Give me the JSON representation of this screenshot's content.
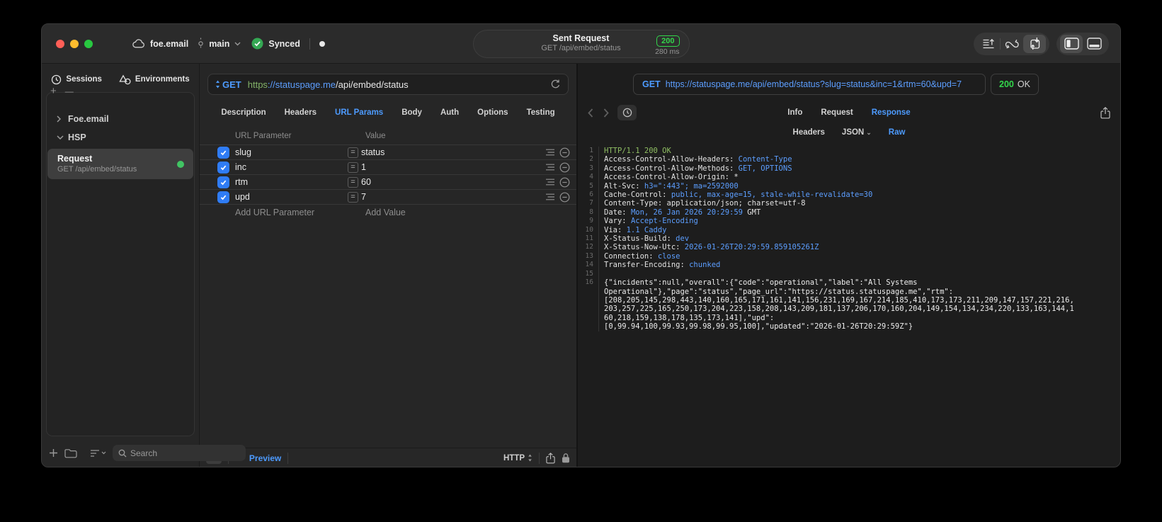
{
  "colors": {
    "accent_blue": "#4D9BFF",
    "status_green": "#32D74B",
    "scheme_green": "#83B268",
    "code_value_blue": "#5C9EFF",
    "code_status_green": "#8FBE63",
    "checkbox_blue": "#2F7CF6",
    "synced_dot_green": "#41C463"
  },
  "titlebar": {
    "project": "foe.email",
    "branch": "main",
    "sync_label": "Synced",
    "request_title": "Sent Request",
    "request_subtitle": "GET /api/embed/status",
    "status_code": "200",
    "duration": "280 ms"
  },
  "sidebar": {
    "tabs": {
      "sessions": "Sessions",
      "environments": "Environments"
    },
    "add_label": "+",
    "remove_label": "—",
    "tree": {
      "group1": "Foe.email",
      "group2": "HSP"
    },
    "request_item": {
      "title": "Request",
      "subtitle": "GET /api/embed/status"
    },
    "search_placeholder": "Search"
  },
  "request_pane": {
    "method": "GET",
    "url": {
      "scheme": "https",
      "host": "://statuspage.me",
      "path": "/api/embed/status"
    },
    "tabs": [
      "Description",
      "Headers",
      "URL Params",
      "Body",
      "Auth",
      "Options",
      "Testing"
    ],
    "active_tab": "URL Params",
    "table": {
      "col_param": "URL Parameter",
      "col_value": "Value",
      "eq": "=",
      "rows": [
        {
          "name": "slug",
          "value": "status",
          "checked": true
        },
        {
          "name": "inc",
          "value": "1",
          "checked": true
        },
        {
          "name": "rtm",
          "value": "60",
          "checked": true
        },
        {
          "name": "upd",
          "value": "7",
          "checked": true
        }
      ],
      "add_param_label": "Add URL Parameter",
      "add_value_label": "Add Value"
    },
    "footer": {
      "code_glyph": "</>",
      "preview_label": "Preview",
      "protocol": "HTTP"
    }
  },
  "response_pane": {
    "method": "GET",
    "url": "https://statuspage.me/api/embed/status?slug=status&inc=1&rtm=60&upd=7",
    "status_code": "200",
    "status_text": "OK",
    "tabs": [
      "Info",
      "Request",
      "Response"
    ],
    "active_tab": "Response",
    "subtabs": [
      "Headers",
      "JSON",
      "Raw"
    ],
    "active_subtab": "Raw",
    "code": {
      "status_line": "HTTP/1.1 200 OK",
      "headers": [
        {
          "name": "Access-Control-Allow-Headers",
          "value": "Content-Type"
        },
        {
          "name": "Access-Control-Allow-Methods",
          "value": "GET, OPTIONS"
        },
        {
          "name": "Access-Control-Allow-Origin",
          "value": "",
          "plain": "*"
        },
        {
          "name": "Alt-Svc",
          "value": "h3=\":443\"; ma=2592000"
        },
        {
          "name": "Cache-Control",
          "value": "public, max-age=15, stale-while-revalidate=30"
        },
        {
          "name": "Content-Type",
          "value": "",
          "plain": "application/json; charset=utf-8"
        },
        {
          "name": "Date",
          "value": "Mon, 26 Jan 2026 20:29:59",
          "plain": " GMT"
        },
        {
          "name": "Vary",
          "value": "Accept-Encoding"
        },
        {
          "name": "Via",
          "value": "1.1 Caddy"
        },
        {
          "name": "X-Status-Build",
          "value": "dev"
        },
        {
          "name": "X-Status-Now-Utc",
          "value": "2026-01-26T20:29:59.859105261Z"
        },
        {
          "name": "Connection",
          "value": "close"
        },
        {
          "name": "Transfer-Encoding",
          "value": "chunked"
        }
      ],
      "body_lines": [
        "{\"incidents\":null,\"overall\":{\"code\":\"operational\",\"label\":\"All Systems",
        "Operational\"},\"page\":\"status\",\"page_url\":\"https://status.statuspage.me\",\"rtm\":",
        "[208,205,145,298,443,140,160,165,171,161,141,156,231,169,167,214,185,410,173,173,211,209,147,157,221,216,",
        "203,257,225,165,250,173,204,223,158,208,143,209,181,137,206,170,160,204,149,154,134,234,220,133,163,144,1",
        "60,218,159,138,178,135,173,141],\"upd\":",
        "[0,99.94,100,99.93,99.98,99.95,100],\"updated\":\"2026-01-26T20:29:59Z\"}"
      ]
    }
  }
}
